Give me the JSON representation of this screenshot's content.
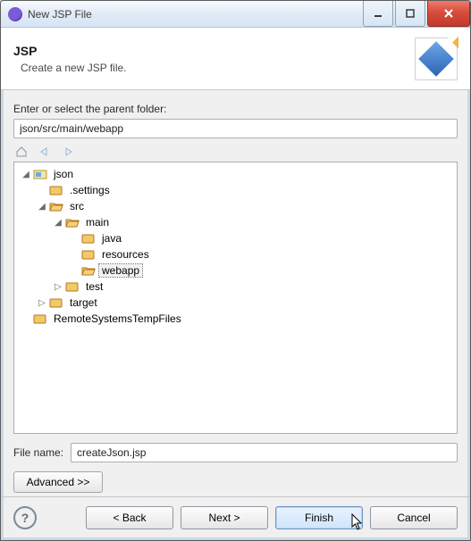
{
  "window": {
    "title": "New JSP File"
  },
  "banner": {
    "title": "JSP",
    "subtitle": "Create a new JSP file."
  },
  "parentFolder": {
    "label": "Enter or select the parent folder:",
    "value": "json/src/main/webapp"
  },
  "tree": {
    "json": "json",
    "settings": ".settings",
    "src": "src",
    "main": "main",
    "java": "java",
    "resources": "resources",
    "webapp": "webapp",
    "test": "test",
    "target": "target",
    "remote": "RemoteSystemsTempFiles"
  },
  "file": {
    "label": "File name:",
    "value": "createJson.jsp"
  },
  "buttons": {
    "advanced": "Advanced >>",
    "back": "< Back",
    "next": "Next >",
    "finish": "Finish",
    "cancel": "Cancel",
    "help": "?"
  }
}
